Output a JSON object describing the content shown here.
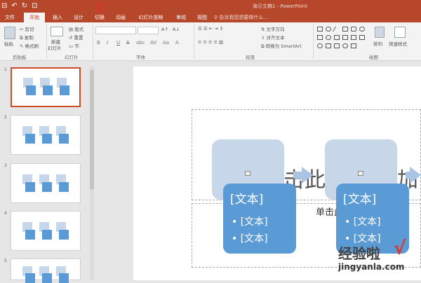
{
  "app": {
    "document_title": "演示文稿1 - PowerPoint"
  },
  "quick_access": [
    "⊟",
    "↶",
    "↻",
    "⊡"
  ],
  "tabs": [
    {
      "label": "文件",
      "active": false
    },
    {
      "label": "开始",
      "active": true
    },
    {
      "label": "插入",
      "active": false
    },
    {
      "label": "设计",
      "active": false
    },
    {
      "label": "切换",
      "active": false
    },
    {
      "label": "动画",
      "active": false
    },
    {
      "label": "幻灯片放映",
      "active": false
    },
    {
      "label": "审阅",
      "active": false
    },
    {
      "label": "视图",
      "active": false
    }
  ],
  "tell_me": "告诉我您想要做什么...",
  "ribbon": {
    "clipboard": {
      "paste": "粘贴",
      "cut": "剪切",
      "copy": "复制",
      "format_painter": "格式刷",
      "label": "剪贴板"
    },
    "slides": {
      "new_slide": "新建",
      "new_slide2": "幻灯片",
      "layout": "版式",
      "reset": "重置",
      "section": "节",
      "label": "幻灯片"
    },
    "font": {
      "label": "字体",
      "format_buttons": [
        "B",
        "I",
        "U",
        "S",
        "abc",
        "AV",
        "Aa",
        "A"
      ]
    },
    "paragraph": {
      "text_direction": "文字方向",
      "align_text": "对齐文本",
      "smartart": "转换为 SmartArt",
      "label": "段落"
    },
    "drawing": {
      "arrange": "排列",
      "quick_styles": "快速样式",
      "label": "绘图"
    }
  },
  "slide_panel": {
    "numbers": [
      "1",
      "2",
      "3",
      "4",
      "5"
    ],
    "selected_index": 0
  },
  "slide": {
    "background_text_left": "击此",
    "background_text_right": "加",
    "subtitle": "单击此处添加副标题",
    "cards": [
      {
        "title": "[文本]",
        "bullets": [
          "• [文本]",
          "• [文本]"
        ]
      },
      {
        "title": "[文本]",
        "bullets": [
          "• [文本]",
          "• [文本]"
        ]
      }
    ]
  },
  "watermark": {
    "chinese": "经验啦",
    "check": "√",
    "url": "jingyanla.com"
  },
  "colors": {
    "ribbon_accent": "#b7472a",
    "smartart_light": "#c8d6ea",
    "smartart_dark": "#5b9bd5",
    "selected_outline": "#d04a28"
  }
}
